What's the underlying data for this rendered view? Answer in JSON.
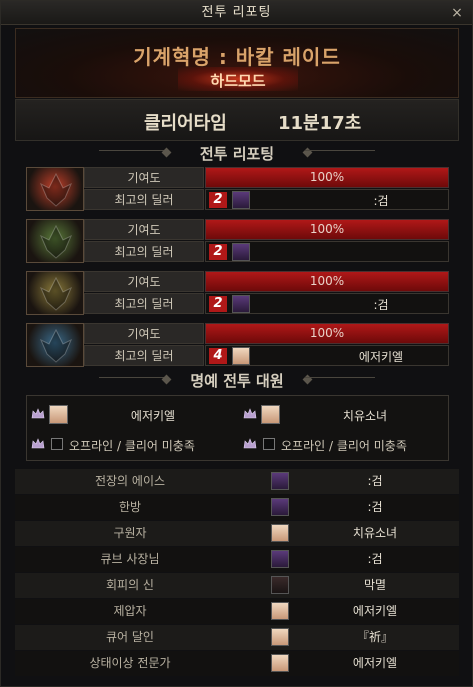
{
  "window": {
    "title": "전투 리포팅",
    "close_symbol": "×"
  },
  "raid": {
    "name": "기계혁명 : 바칼 레이드",
    "mode": "하드모드"
  },
  "clear": {
    "label": "클리어타임",
    "value": "11분17초"
  },
  "section_battle": "전투 리포팅",
  "section_honor": "명예 전투 대원",
  "boss_rows": [
    {
      "contribution_label": "기여도",
      "contribution_value": "100%",
      "contribution_pct": 100,
      "dealer_label": "최고의 딜러",
      "rank": "2",
      "dealer_name": ":검",
      "portrait_color": "#c0402a",
      "portrait_icon": "fire-dragon-icon"
    },
    {
      "contribution_label": "기여도",
      "contribution_value": "100%",
      "contribution_pct": 100,
      "dealer_label": "최고의 딜러",
      "rank": "2",
      "dealer_name": "",
      "portrait_color": "#5a7a3a",
      "portrait_icon": "poison-dragon-icon"
    },
    {
      "contribution_label": "기여도",
      "contribution_value": "100%",
      "contribution_pct": 100,
      "dealer_label": "최고의 딜러",
      "rank": "2",
      "dealer_name": ":검",
      "portrait_color": "#8a7a3a",
      "portrait_icon": "gold-dragon-icon"
    },
    {
      "contribution_label": "기여도",
      "contribution_value": "100%",
      "contribution_pct": 100,
      "dealer_label": "최고의 딜러",
      "rank": "4",
      "dealer_name": "에저키엘",
      "portrait_color": "#3a6a8a",
      "portrait_icon": "ice-dragon-icon"
    }
  ],
  "honor": [
    {
      "name": "에저키엘",
      "type": "player"
    },
    {
      "name": "치유소녀",
      "type": "player"
    },
    {
      "name": "오프라인 / 클리어 미충족",
      "type": "offline"
    },
    {
      "name": "오프라인 / 클리어 미충족",
      "type": "offline"
    }
  ],
  "awards": [
    {
      "title": "전장의 에이스",
      "name": ":검"
    },
    {
      "title": "한방",
      "name": ":검"
    },
    {
      "title": "구원자",
      "name": "치유소녀"
    },
    {
      "title": "큐브 사장님",
      "name": ":검"
    },
    {
      "title": "회피의 신",
      "name": "막멸"
    },
    {
      "title": "제압자",
      "name": "에저키엘"
    },
    {
      "title": "큐어 달인",
      "name": "『祈』"
    },
    {
      "title": "상태이상 전문가",
      "name": "에저키엘"
    }
  ],
  "colors": {
    "bar_fill": "#b01818",
    "rank_badge": "#b01818",
    "raid_title": "#d9a36a",
    "avatar_dark": "#4a3a6a",
    "avatar_light": "#e8c8a8"
  }
}
